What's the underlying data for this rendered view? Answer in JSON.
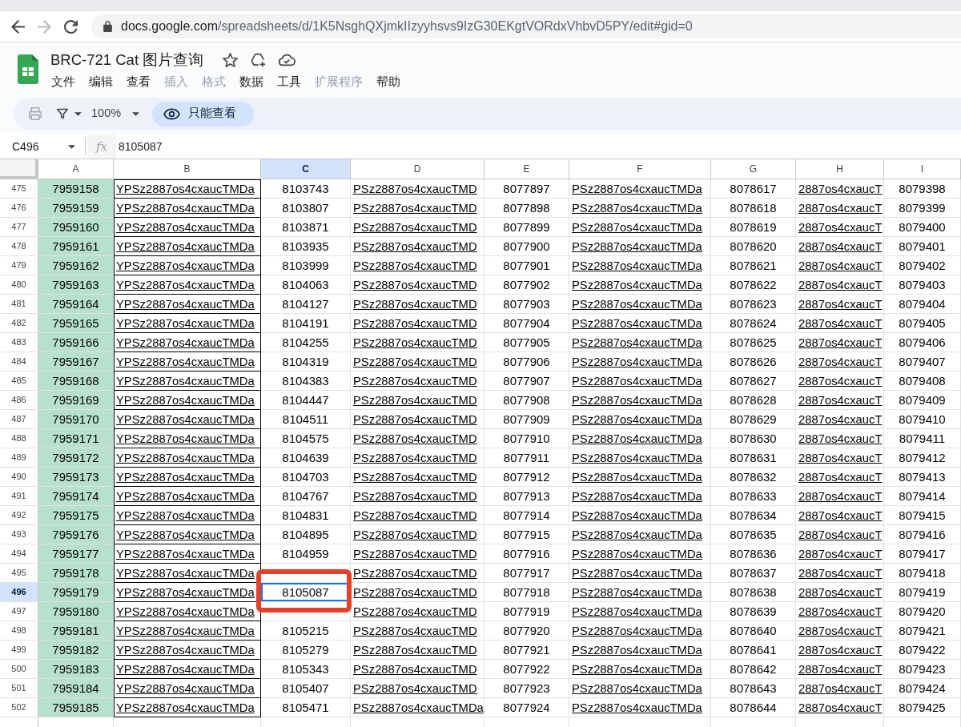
{
  "browser": {
    "forward_disabled": true,
    "address_host": "docs.google.com",
    "address_path": "/spreadsheets/d/1K5NsghQXjmkIIzyyhsvs9IzG30EKgtVORdxVhbvD5PY/edit#gid=0"
  },
  "document": {
    "title": "BRC-721 Cat 图片查询"
  },
  "menu": [
    {
      "label": "文件",
      "disabled": false
    },
    {
      "label": "编辑",
      "disabled": false
    },
    {
      "label": "查看",
      "disabled": false
    },
    {
      "label": "插入",
      "disabled": true
    },
    {
      "label": "格式",
      "disabled": true
    },
    {
      "label": "数据",
      "disabled": false
    },
    {
      "label": "工具",
      "disabled": false
    },
    {
      "label": "扩展程序",
      "disabled": true
    },
    {
      "label": "帮助",
      "disabled": false
    }
  ],
  "toolbar": {
    "print_disabled": true,
    "zoom": "100%",
    "view_only_label": "只能查看"
  },
  "formula_bar": {
    "cell_ref": "C496",
    "function_label": "fx",
    "value": "8105087"
  },
  "sheet": {
    "columns": [
      {
        "label": "A",
        "kind": "filled",
        "selected": false
      },
      {
        "label": "B",
        "kind": "boxed_link",
        "selected": false
      },
      {
        "label": "C",
        "kind": "plain",
        "selected": true
      },
      {
        "label": "D",
        "kind": "link",
        "selected": false
      },
      {
        "label": "E",
        "kind": "plain",
        "selected": false
      },
      {
        "label": "F",
        "kind": "link",
        "selected": false
      },
      {
        "label": "G",
        "kind": "plain",
        "selected": false
      },
      {
        "label": "H",
        "kind": "link",
        "selected": false
      },
      {
        "label": "I",
        "kind": "plain",
        "selected": false
      }
    ],
    "rows": [
      {
        "number": "475",
        "selected": false,
        "cells": [
          "7959158",
          "YPSz2887os4cxaucTMDa",
          "8103743",
          "PSz2887os4cxaucTMD",
          "8077897",
          "PSz2887os4cxaucTMDa",
          "8078617",
          "2887os4cxaucT",
          "8079398"
        ]
      },
      {
        "number": "476",
        "selected": false,
        "cells": [
          "7959159",
          "YPSz2887os4cxaucTMDa",
          "8103807",
          "PSz2887os4cxaucTMD",
          "8077898",
          "PSz2887os4cxaucTMDa",
          "8078618",
          "2887os4cxaucT",
          "8079399"
        ]
      },
      {
        "number": "477",
        "selected": false,
        "cells": [
          "7959160",
          "YPSz2887os4cxaucTMDa",
          "8103871",
          "PSz2887os4cxaucTMD",
          "8077899",
          "PSz2887os4cxaucTMDa",
          "8078619",
          "2887os4cxaucT",
          "8079400"
        ]
      },
      {
        "number": "478",
        "selected": false,
        "cells": [
          "7959161",
          "YPSz2887os4cxaucTMDa",
          "8103935",
          "PSz2887os4cxaucTMD",
          "8077900",
          "PSz2887os4cxaucTMDa",
          "8078620",
          "2887os4cxaucT",
          "8079401"
        ]
      },
      {
        "number": "479",
        "selected": false,
        "cells": [
          "7959162",
          "YPSz2887os4cxaucTMDa",
          "8103999",
          "PSz2887os4cxaucTMD",
          "8077901",
          "PSz2887os4cxaucTMDa",
          "8078621",
          "2887os4cxaucT",
          "8079402"
        ]
      },
      {
        "number": "480",
        "selected": false,
        "cells": [
          "7959163",
          "YPSz2887os4cxaucTMDa",
          "8104063",
          "PSz2887os4cxaucTMD",
          "8077902",
          "PSz2887os4cxaucTMDa",
          "8078622",
          "2887os4cxaucT",
          "8079403"
        ]
      },
      {
        "number": "481",
        "selected": false,
        "cells": [
          "7959164",
          "YPSz2887os4cxaucTMDa",
          "8104127",
          "PSz2887os4cxaucTMD",
          "8077903",
          "PSz2887os4cxaucTMDa",
          "8078623",
          "2887os4cxaucT",
          "8079404"
        ]
      },
      {
        "number": "482",
        "selected": false,
        "cells": [
          "7959165",
          "YPSz2887os4cxaucTMDa",
          "8104191",
          "PSz2887os4cxaucTMD",
          "8077904",
          "PSz2887os4cxaucTMDa",
          "8078624",
          "2887os4cxaucT",
          "8079405"
        ]
      },
      {
        "number": "483",
        "selected": false,
        "cells": [
          "7959166",
          "YPSz2887os4cxaucTMDa",
          "8104255",
          "PSz2887os4cxaucTMD",
          "8077905",
          "PSz2887os4cxaucTMDa",
          "8078625",
          "2887os4cxaucT",
          "8079406"
        ]
      },
      {
        "number": "484",
        "selected": false,
        "cells": [
          "7959167",
          "YPSz2887os4cxaucTMDa",
          "8104319",
          "PSz2887os4cxaucTMD",
          "8077906",
          "PSz2887os4cxaucTMDa",
          "8078626",
          "2887os4cxaucT",
          "8079407"
        ]
      },
      {
        "number": "485",
        "selected": false,
        "cells": [
          "7959168",
          "YPSz2887os4cxaucTMDa",
          "8104383",
          "PSz2887os4cxaucTMD",
          "8077907",
          "PSz2887os4cxaucTMDa",
          "8078627",
          "2887os4cxaucT",
          "8079408"
        ]
      },
      {
        "number": "486",
        "selected": false,
        "cells": [
          "7959169",
          "YPSz2887os4cxaucTMDa",
          "8104447",
          "PSz2887os4cxaucTMD",
          "8077908",
          "PSz2887os4cxaucTMDa",
          "8078628",
          "2887os4cxaucT",
          "8079409"
        ]
      },
      {
        "number": "487",
        "selected": false,
        "cells": [
          "7959170",
          "YPSz2887os4cxaucTMDa",
          "8104511",
          "PSz2887os4cxaucTMD",
          "8077909",
          "PSz2887os4cxaucTMDa",
          "8078629",
          "2887os4cxaucT",
          "8079410"
        ]
      },
      {
        "number": "488",
        "selected": false,
        "cells": [
          "7959171",
          "YPSz2887os4cxaucTMDa",
          "8104575",
          "PSz2887os4cxaucTMD",
          "8077910",
          "PSz2887os4cxaucTMDa",
          "8078630",
          "2887os4cxaucT",
          "8079411"
        ]
      },
      {
        "number": "489",
        "selected": false,
        "cells": [
          "7959172",
          "YPSz2887os4cxaucTMDa",
          "8104639",
          "PSz2887os4cxaucTMD",
          "8077911",
          "PSz2887os4cxaucTMDa",
          "8078631",
          "2887os4cxaucT",
          "8079412"
        ]
      },
      {
        "number": "490",
        "selected": false,
        "cells": [
          "7959173",
          "YPSz2887os4cxaucTMDa",
          "8104703",
          "PSz2887os4cxaucTMD",
          "8077912",
          "PSz2887os4cxaucTMDa",
          "8078632",
          "2887os4cxaucT",
          "8079413"
        ]
      },
      {
        "number": "491",
        "selected": false,
        "cells": [
          "7959174",
          "YPSz2887os4cxaucTMDa",
          "8104767",
          "PSz2887os4cxaucTMD",
          "8077913",
          "PSz2887os4cxaucTMDa",
          "8078633",
          "2887os4cxaucT",
          "8079414"
        ]
      },
      {
        "number": "492",
        "selected": false,
        "cells": [
          "7959175",
          "YPSz2887os4cxaucTMDa",
          "8104831",
          "PSz2887os4cxaucTMD",
          "8077914",
          "PSz2887os4cxaucTMDa",
          "8078634",
          "2887os4cxaucT",
          "8079415"
        ]
      },
      {
        "number": "493",
        "selected": false,
        "cells": [
          "7959176",
          "YPSz2887os4cxaucTMDa",
          "8104895",
          "PSz2887os4cxaucTMD",
          "8077915",
          "PSz2887os4cxaucTMDa",
          "8078635",
          "2887os4cxaucT",
          "8079416"
        ]
      },
      {
        "number": "494",
        "selected": false,
        "cells": [
          "7959177",
          "YPSz2887os4cxaucTMDa",
          "8104959",
          "PSz2887os4cxaucTMD",
          "8077916",
          "PSz2887os4cxaucTMDa",
          "8078636",
          "2887os4cxaucT",
          "8079417"
        ]
      },
      {
        "number": "495",
        "selected": false,
        "cells": [
          "7959178",
          "YPSz2887os4cxaucTMDa",
          null,
          "PSz2887os4cxaucTMD",
          "8077917",
          "PSz2887os4cxaucTMDa",
          "8078637",
          "2887os4cxaucT",
          "8079418"
        ]
      },
      {
        "number": "496",
        "selected": true,
        "cells": [
          "7959179",
          "YPSz2887os4cxaucTMDa",
          "8105087",
          "PSz2887os4cxaucTMD",
          "8077918",
          "PSz2887os4cxaucTMDa",
          "8078638",
          "2887os4cxaucT",
          "8079419"
        ]
      },
      {
        "number": "497",
        "selected": false,
        "cells": [
          "7959180",
          "YPSz2887os4cxaucTMDa",
          null,
          "PSz2887os4cxaucTMD",
          "8077919",
          "PSz2887os4cxaucTMDa",
          "8078639",
          "2887os4cxaucT",
          "8079420"
        ]
      },
      {
        "number": "498",
        "selected": false,
        "cells": [
          "7959181",
          "YPSz2887os4cxaucTMDa",
          "8105215",
          "PSz2887os4cxaucTMD",
          "8077920",
          "PSz2887os4cxaucTMDa",
          "8078640",
          "2887os4cxaucT",
          "8079421"
        ]
      },
      {
        "number": "499",
        "selected": false,
        "cells": [
          "7959182",
          "YPSz2887os4cxaucTMDa",
          "8105279",
          "PSz2887os4cxaucTMD",
          "8077921",
          "PSz2887os4cxaucTMDa",
          "8078641",
          "2887os4cxaucT",
          "8079422"
        ]
      },
      {
        "number": "500",
        "selected": false,
        "cells": [
          "7959183",
          "YPSz2887os4cxaucTMDa",
          "8105343",
          "PSz2887os4cxaucTMD",
          "8077922",
          "PSz2887os4cxaucTMDa",
          "8078642",
          "2887os4cxaucT",
          "8079423"
        ]
      },
      {
        "number": "501",
        "selected": false,
        "cells": [
          "7959184",
          "YPSz2887os4cxaucTMDa",
          "8105407",
          "PSz2887os4cxaucTMD",
          "8077923",
          "PSz2887os4cxaucTMDa",
          "8078643",
          "2887os4cxaucT",
          "8079424"
        ]
      },
      {
        "number": "502",
        "selected": false,
        "cells": [
          "7959185",
          "YPSz2887os4cxaucTMDa",
          "8105471",
          "PSz2887os4cxaucTMDa",
          "8077924",
          "PSz2887os4cxaucTMDa",
          "8078644",
          "2887os4cxaucT",
          "8079425"
        ]
      }
    ]
  }
}
